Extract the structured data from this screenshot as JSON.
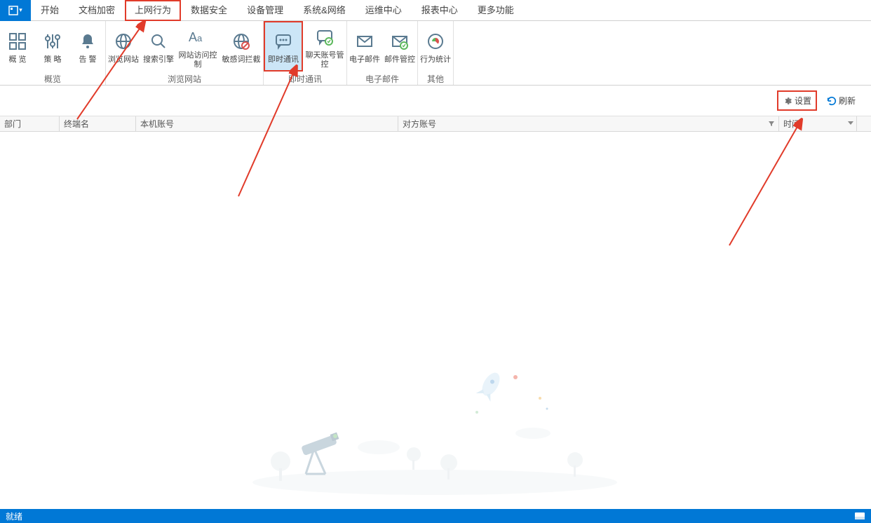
{
  "menu": {
    "items": [
      "开始",
      "文档加密",
      "上网行为",
      "数据安全",
      "设备管理",
      "系统&网络",
      "运维中心",
      "报表中心",
      "更多功能"
    ],
    "highlighted_index": 2
  },
  "ribbon": {
    "groups": [
      {
        "label": "概览",
        "items": [
          {
            "icon": "grid-icon",
            "label": "概 览"
          },
          {
            "icon": "sliders-icon",
            "label": "策 略"
          },
          {
            "icon": "bell-icon",
            "label": "告 警"
          }
        ]
      },
      {
        "label": "浏览网站",
        "items": [
          {
            "icon": "globe-icon",
            "label": "浏览网站"
          },
          {
            "icon": "search-icon",
            "label": "搜索引擎"
          },
          {
            "icon": "text-aa-icon",
            "label": "网站访问控制",
            "wide": true
          },
          {
            "icon": "globe-block-icon",
            "label": "敏感词拦截",
            "wide": true
          }
        ]
      },
      {
        "label": "即时通讯",
        "items": [
          {
            "icon": "chat-icon",
            "label": "即时通讯",
            "selected": true
          },
          {
            "icon": "chat-lock-icon",
            "label": "聊天账号管控",
            "wide": true
          }
        ]
      },
      {
        "label": "电子邮件",
        "items": [
          {
            "icon": "mail-icon",
            "label": "电子邮件"
          },
          {
            "icon": "mail-lock-icon",
            "label": "邮件管控"
          }
        ]
      },
      {
        "label": "其他",
        "items": [
          {
            "icon": "globe-stats-icon",
            "label": "行为统计"
          }
        ]
      }
    ]
  },
  "toolbar": {
    "settings_label": "设置",
    "refresh_label": "刷新"
  },
  "columns": {
    "c0": "部门",
    "c1": "终端名",
    "c2": "本机账号",
    "c3": "对方账号",
    "c4": "时间"
  },
  "status": {
    "text": "就绪"
  },
  "colors": {
    "accent": "#0178d6",
    "highlight": "#e13b2a",
    "selected_bg": "#cce6f7"
  }
}
